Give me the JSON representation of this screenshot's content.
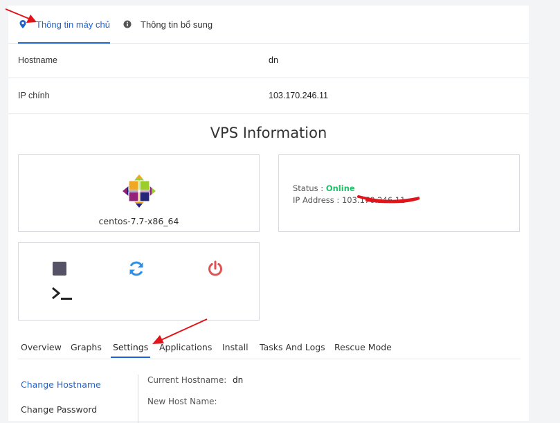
{
  "top_tabs": [
    {
      "label": "Thông tin máy chủ",
      "icon": "map-pin-icon",
      "active": true
    },
    {
      "label": "Thông tin bổ sung",
      "icon": "info-icon",
      "active": false
    }
  ],
  "info_rows": [
    {
      "label": "Hostname",
      "value": "dn"
    },
    {
      "label": "IP chính",
      "value": "103.170.246.11"
    }
  ],
  "vps": {
    "title": "VPS Information",
    "os_name": "centos-7.7-x86_64",
    "os_logo_icon": "centos-logo-icon",
    "status_label": "Status :",
    "status_value": "Online",
    "ip_label": "IP Address :",
    "ip_value": "103.170.246.11"
  },
  "actions": [
    {
      "name": "stop",
      "icon": "stop-icon",
      "color": "#555266"
    },
    {
      "name": "restart",
      "icon": "refresh-icon",
      "color": "#2f8ee5"
    },
    {
      "name": "power",
      "icon": "power-icon",
      "color": "#e05252"
    },
    {
      "name": "console",
      "icon": "terminal-icon",
      "color": "#222"
    }
  ],
  "bottom_tabs": [
    {
      "label": "Overview",
      "active": false
    },
    {
      "label": "Graphs",
      "active": false
    },
    {
      "label": "Settings",
      "active": true
    },
    {
      "label": "Applications",
      "active": false
    },
    {
      "label": "Install",
      "active": false
    },
    {
      "label": "Tasks And Logs",
      "active": false
    },
    {
      "label": "Rescue Mode",
      "active": false
    }
  ],
  "settings": {
    "side_links": [
      "Change Hostname",
      "Change Password"
    ],
    "current_hostname_label": "Current Hostname:",
    "current_hostname_value": "dn",
    "new_hostname_label": "New Host Name:"
  },
  "colors": {
    "accent": "#1e63d6",
    "online": "#21c06b",
    "annotation": "#e0151b"
  }
}
